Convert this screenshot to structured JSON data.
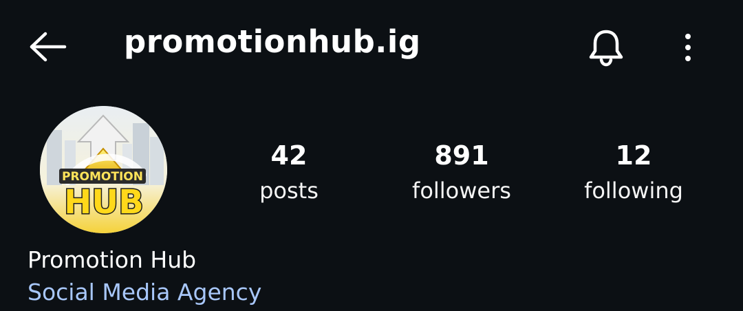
{
  "header": {
    "back_icon": "arrow-left-icon",
    "username": "promotionhub.ig",
    "notifications_icon": "bell-icon",
    "more_icon": "more-vertical-icon"
  },
  "avatar": {
    "logo_text_top": "PROMOTION",
    "logo_text_bottom": "HUB"
  },
  "stats": {
    "posts": {
      "value": "42",
      "label": "posts"
    },
    "followers": {
      "value": "891",
      "label": "followers"
    },
    "following": {
      "value": "12",
      "label": "following"
    }
  },
  "bio": {
    "display_name": "Promotion Hub",
    "category": "Social Media Agency"
  },
  "colors": {
    "background": "#0c1014",
    "text": "#f5f5f5",
    "category_link": "#a8c7fa",
    "logo_yellow": "#f7d117"
  }
}
